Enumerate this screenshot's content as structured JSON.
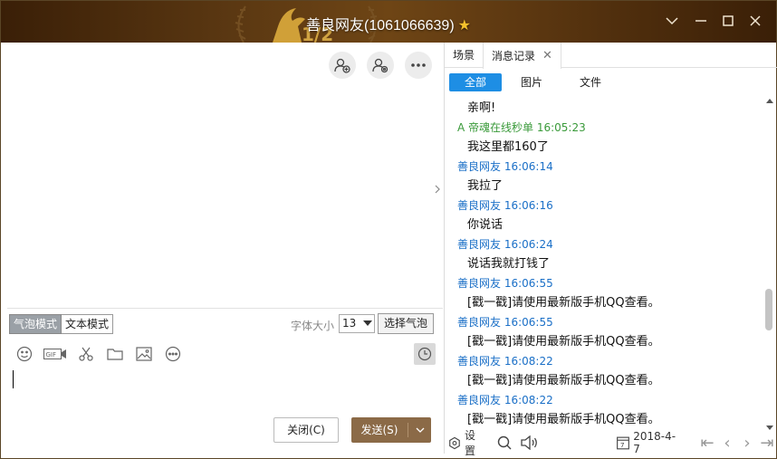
{
  "window": {
    "title": "善良网友(1061066639)",
    "title_star": "★",
    "emblem_text": "1/2",
    "accent_color": "#1e8ee4",
    "send_color": "#8b6a47"
  },
  "left": {
    "mode_bubble": "气泡模式",
    "mode_text": "文本模式",
    "font_size_label": "字体大小",
    "font_size_value": "13",
    "bubble_select_label": "选择气泡",
    "close_button": "关闭(C)",
    "send_button": "发送(S)"
  },
  "right": {
    "tab_scene": "场景",
    "tab_history": "消息记录",
    "filter_all": "全部",
    "filter_images": "图片",
    "filter_files": "文件",
    "messages": [
      {
        "type": "body",
        "text": "亲啊!"
      },
      {
        "type": "meta",
        "text": "A    帝魂在线秒单 16:05:23",
        "green": true
      },
      {
        "type": "body",
        "text": "我这里都160了"
      },
      {
        "type": "meta",
        "text": "善良网友 16:06:14"
      },
      {
        "type": "body",
        "text": "我拉了"
      },
      {
        "type": "meta",
        "text": "善良网友 16:06:16"
      },
      {
        "type": "body",
        "text": "你说话"
      },
      {
        "type": "meta",
        "text": "善良网友 16:06:24"
      },
      {
        "type": "body",
        "text": "说话我就打钱了"
      },
      {
        "type": "meta",
        "text": "善良网友 16:06:55"
      },
      {
        "type": "body",
        "text": "[戳一戳]请使用最新版手机QQ查看。"
      },
      {
        "type": "meta",
        "text": "善良网友 16:06:55"
      },
      {
        "type": "body",
        "text": "[戳一戳]请使用最新版手机QQ查看。"
      },
      {
        "type": "meta",
        "text": "善良网友 16:08:22"
      },
      {
        "type": "body",
        "text": "[戳一戳]请使用最新版手机QQ查看。"
      },
      {
        "type": "meta",
        "text": "善良网友 16:08:22"
      },
      {
        "type": "body",
        "text": "[戳一戳]请使用最新版手机QQ查看。"
      }
    ],
    "settings_label": "设置",
    "date": "2018-4-7",
    "calendar_day": "7"
  }
}
